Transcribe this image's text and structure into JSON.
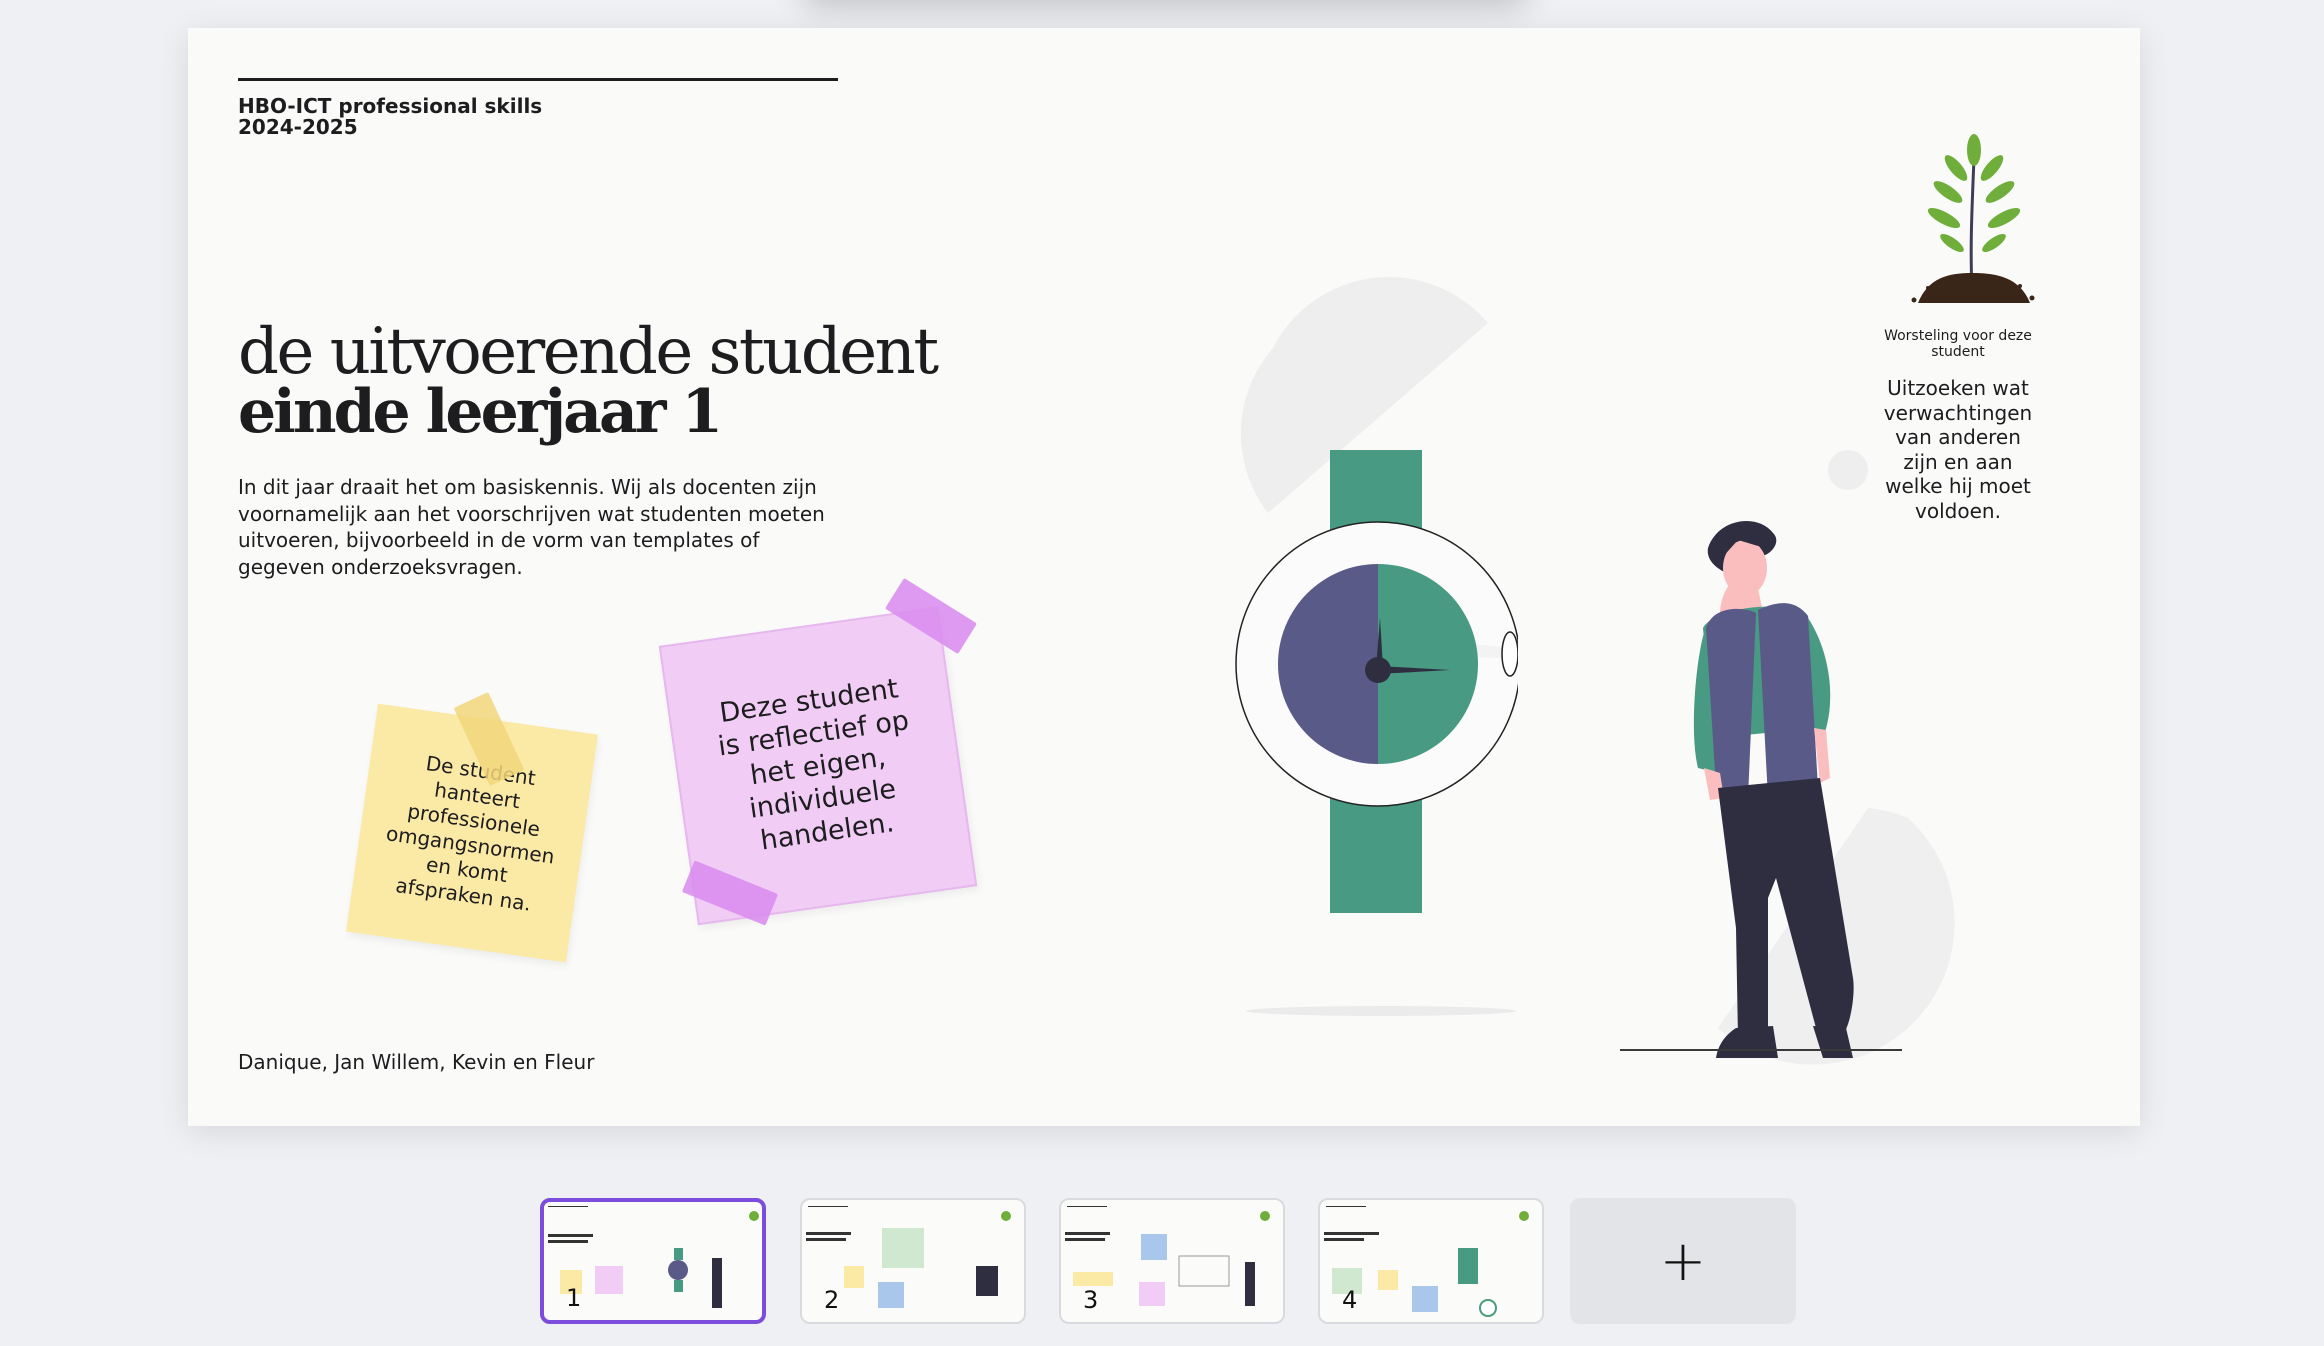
{
  "slide": {
    "course_lines": "HBO-ICT professional skills\n2024-2025",
    "title_line1": "de uitvoerende student",
    "title_line2": "einde leerjaar 1",
    "intro": "In dit jaar draait het om basiskennis. Wij als docenten zijn voornamelijk aan het voorschrijven wat studenten moeten uitvoeren, bijvoorbeeld in de vorm van templates of gegeven onderzoeksvragen.",
    "note_yellow": "De student hanteert professionele omgangsnormen en komt afspraken na.",
    "note_pink": "Deze student is reflectief op het eigen, individuele handelen.",
    "struggle_label": "Worsteling voor deze student",
    "struggle_text": "Uitzoeken wat verwachtingen van anderen zijn en aan welke hij moet voldoen.",
    "authors": "Danique, Jan Willem, Kevin en Fleur"
  },
  "thumbnails": [
    {
      "number": "1",
      "active": true
    },
    {
      "number": "2",
      "active": false
    },
    {
      "number": "3",
      "active": false
    },
    {
      "number": "4",
      "active": false
    }
  ],
  "add_slide_symbol": "+",
  "colors": {
    "accent": "#7c4ddc",
    "watch_green": "#489a82",
    "watch_purple": "#595a88",
    "note_yellow": "#fbe9a6",
    "note_pink": "#f1cdf6"
  },
  "icons": [
    "plant-icon",
    "watch-illustration",
    "person-illustration",
    "plus-icon"
  ]
}
